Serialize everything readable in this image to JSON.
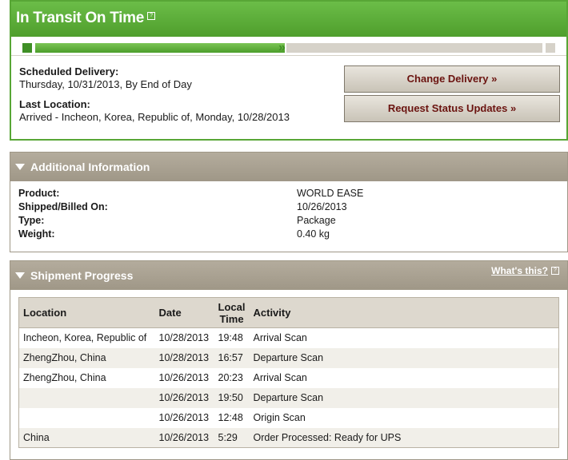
{
  "status": {
    "title": "In Transit On Time",
    "help_icon": "?",
    "progress_fraction": 0.5,
    "scheduled_delivery_label": "Scheduled Delivery:",
    "scheduled_delivery_value": "Thursday, 10/31/2013, By End of Day",
    "last_location_label": "Last Location:",
    "last_location_value": "Arrived - Incheon, Korea, Republic of, Monday, 10/28/2013",
    "buttons": {
      "change_delivery": "Change Delivery »",
      "request_updates": "Request Status Updates »"
    }
  },
  "additional_info": {
    "title": "Additional Information",
    "rows": [
      {
        "label": "Product:",
        "value": "WORLD EASE"
      },
      {
        "label": "Shipped/Billed On:",
        "value": "10/26/2013"
      },
      {
        "label": "Type:",
        "value": "Package"
      },
      {
        "label": "Weight:",
        "value": "0.40 kg"
      }
    ]
  },
  "shipment_progress": {
    "title": "Shipment Progress",
    "whats_this": "What's this?",
    "help_icon": "?",
    "columns": [
      "Location",
      "Date",
      "Local Time",
      "Activity"
    ],
    "rows": [
      {
        "location": "Incheon, Korea, Republic of",
        "date": "10/28/2013",
        "time": "19:48",
        "activity": "Arrival Scan"
      },
      {
        "location": "ZhengZhou, China",
        "date": "10/28/2013",
        "time": "16:57",
        "activity": "Departure Scan"
      },
      {
        "location": "ZhengZhou, China",
        "date": "10/26/2013",
        "time": "20:23",
        "activity": "Arrival Scan"
      },
      {
        "location": "",
        "date": "10/26/2013",
        "time": "19:50",
        "activity": "Departure Scan"
      },
      {
        "location": "",
        "date": "10/26/2013",
        "time": "12:48",
        "activity": "Origin Scan"
      },
      {
        "location": "China",
        "date": "10/26/2013",
        "time": "5:29",
        "activity": "Order Processed: Ready for UPS"
      }
    ]
  },
  "colors": {
    "status_green": "#58a636",
    "section_taupe": "#a39b8b",
    "button_text": "#6b1410"
  }
}
